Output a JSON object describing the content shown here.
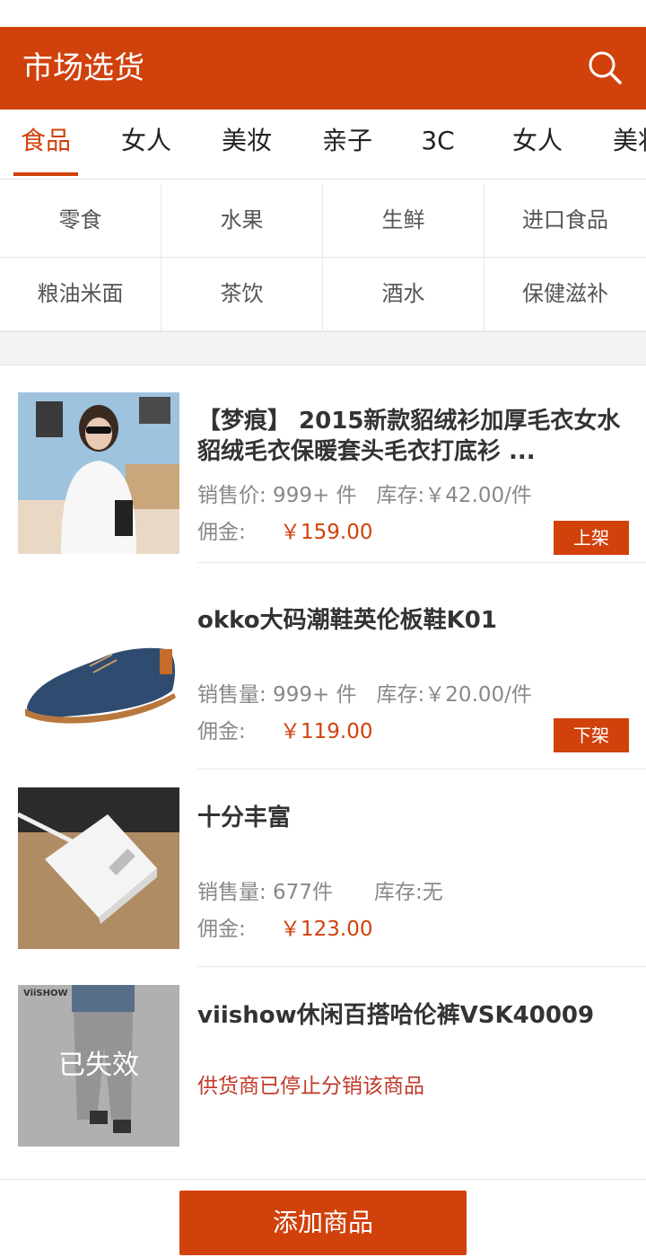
{
  "header": {
    "title": "市场选货",
    "search_icon": "search-icon"
  },
  "tabs": [
    {
      "label": "食品",
      "active": true
    },
    {
      "label": "女人"
    },
    {
      "label": "美妆"
    },
    {
      "label": "亲子"
    },
    {
      "label": "3C"
    },
    {
      "label": "女人"
    },
    {
      "label": "美妆"
    }
  ],
  "subcategories": [
    "零食",
    "水果",
    "生鲜",
    "进口食品",
    "粮油米面",
    "茶饮",
    "酒水",
    "保健滋补"
  ],
  "products": [
    {
      "name": "【梦痕】 2015新款貂绒衫加厚毛衣女水貂绒毛衣保暖套头毛衣打底衫 ...",
      "sales": "销售价: 999+ 件",
      "stock": "库存:￥42.00/件",
      "commission_label": "佣金:",
      "commission": "￥159.00",
      "action": "上架"
    },
    {
      "name": "okko大码潮鞋英伦板鞋K01",
      "sales": "销售量: 999+ 件",
      "stock": "库存:￥20.00/件",
      "commission_label": "佣金:",
      "commission": "￥119.00",
      "action": "下架"
    },
    {
      "name": "十分丰富",
      "sales": "销售量: 677件",
      "stock": "库存:无",
      "commission_label": "佣金:",
      "commission": "￥123.00"
    },
    {
      "name": "viishow休闲百搭哈伦裤VSK40009",
      "expired_label": "已失效",
      "warning": "供货商已停止分销该商品",
      "brand_text": "ViiSHOW"
    }
  ],
  "footer": {
    "add_button": "添加商品"
  },
  "colors": {
    "accent": "#d1410c"
  }
}
